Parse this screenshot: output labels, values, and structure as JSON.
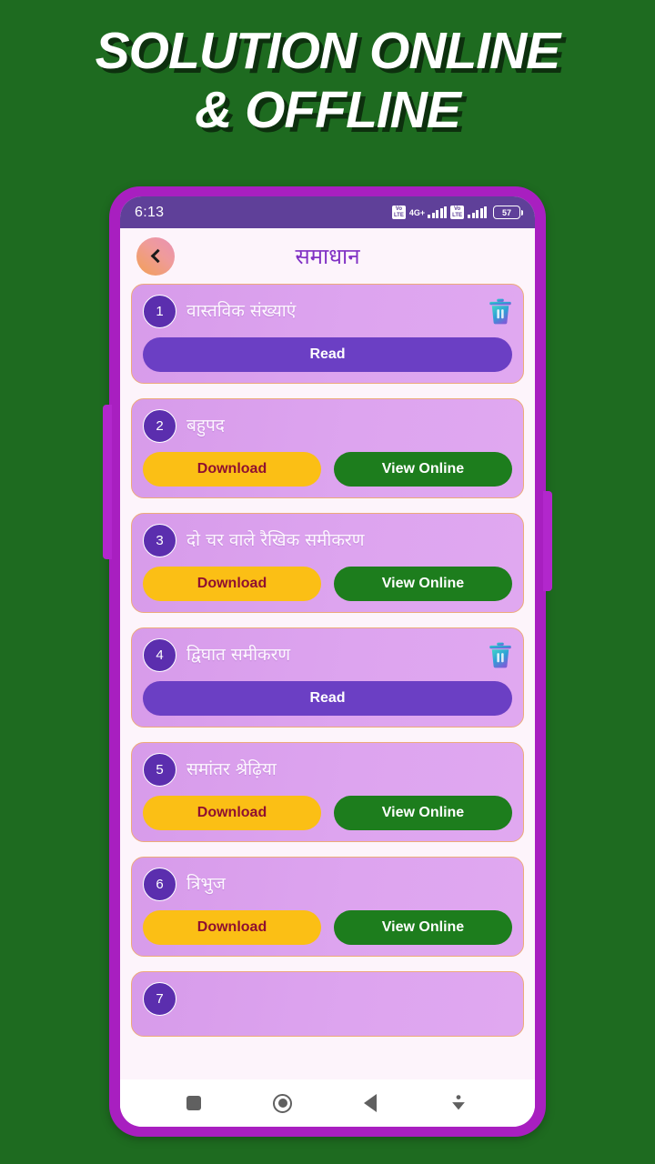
{
  "banner": {
    "headline": "SOLUTION ONLINE\n& OFFLINE"
  },
  "colors": {
    "background_green": "#1e6b20",
    "phone_bezel": "#a81fc0",
    "statusbar": "#5f4099",
    "screen_bg": "#fdf4fb",
    "card_bg": "#dda4ef",
    "card_border": "#edaa7a",
    "number_badge": "#5b2eae",
    "read_button": "#6b3fc4",
    "download_button": "#fbbf15",
    "download_text": "#8f1030",
    "view_online_button": "#1d7d1d",
    "title_purple": "#8030c4",
    "trash_icon": "#35c6c6"
  },
  "statusbar": {
    "time": "6:13",
    "volte_label_1": "Vo\nLTE",
    "network_label": "4G+",
    "volte_label_2": "Vo\nLTE",
    "battery_level": "57"
  },
  "header": {
    "title": "समाधान",
    "back_icon": "chevron-left-icon"
  },
  "list": {
    "items": [
      {
        "number": "1",
        "title": "वास्तविक संख्याएं",
        "has_trash": true,
        "buttons": [
          {
            "label": "Read",
            "style": "read"
          }
        ]
      },
      {
        "number": "2",
        "title": "बहुपद",
        "has_trash": false,
        "buttons": [
          {
            "label": "Download",
            "style": "download"
          },
          {
            "label": "View Online",
            "style": "online"
          }
        ]
      },
      {
        "number": "3",
        "title": "दो चर वाले रैखिक समीकरण",
        "has_trash": false,
        "buttons": [
          {
            "label": "Download",
            "style": "download"
          },
          {
            "label": "View Online",
            "style": "online"
          }
        ]
      },
      {
        "number": "4",
        "title": "द्विघात समीकरण",
        "has_trash": true,
        "buttons": [
          {
            "label": "Read",
            "style": "read"
          }
        ]
      },
      {
        "number": "5",
        "title": "समांतर श्रेढ़िया",
        "has_trash": false,
        "buttons": [
          {
            "label": "Download",
            "style": "download"
          },
          {
            "label": "View Online",
            "style": "online"
          }
        ]
      },
      {
        "number": "6",
        "title": "त्रिभुज",
        "has_trash": false,
        "buttons": [
          {
            "label": "Download",
            "style": "download"
          },
          {
            "label": "View Online",
            "style": "online"
          }
        ]
      },
      {
        "number": "7",
        "title": "",
        "has_trash": false,
        "partial": true,
        "buttons": []
      }
    ]
  },
  "navbar": {
    "items": [
      {
        "icon": "square-recents-icon",
        "label": "Recents"
      },
      {
        "icon": "circle-home-icon",
        "label": "Home"
      },
      {
        "icon": "triangle-back-icon",
        "label": "Back"
      },
      {
        "icon": "chevron-down-hide-icon",
        "label": "Hide navigation bar"
      }
    ]
  }
}
